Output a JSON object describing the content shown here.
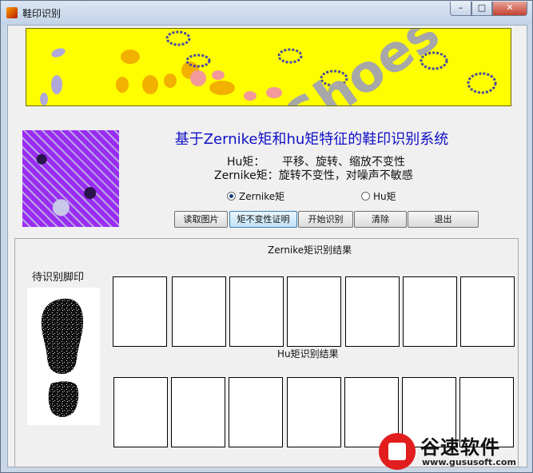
{
  "window": {
    "title": "鞋印识别",
    "controls": {
      "minimize": "–",
      "maximize": "□",
      "close": "✕"
    }
  },
  "banner": {
    "word": "Shoes",
    "background_color": "#fefe00"
  },
  "header": {
    "title": "基于Zernike矩和hu矩特征的鞋印识别系统",
    "hu_label": "Hu矩：",
    "hu_text": "平移、旋转、缩放不变性",
    "zernike_line": "Zernike矩：旋转不变性，对噪声不敏感"
  },
  "radios": {
    "zernike": {
      "label": "Zernike矩",
      "checked": true
    },
    "hu": {
      "label": "Hu矩",
      "checked": false
    }
  },
  "buttons": {
    "read_image": "读取图片",
    "moment_invariance": "矩不变性证明",
    "start_recognition": "开始识别",
    "clear": "清除",
    "exit": "退出"
  },
  "results": {
    "zernike_title": "Zernike矩识别结果",
    "hu_title": "Hu矩识别结果",
    "query_label": "待识别脚印",
    "zernike_result_count": 7,
    "hu_result_count": 7
  },
  "watermark": {
    "name": "谷速软件",
    "url": "www.gususoft.com"
  },
  "colors": {
    "title_blue": "#1010c8",
    "pattern_purple": "#9a2cf2"
  }
}
